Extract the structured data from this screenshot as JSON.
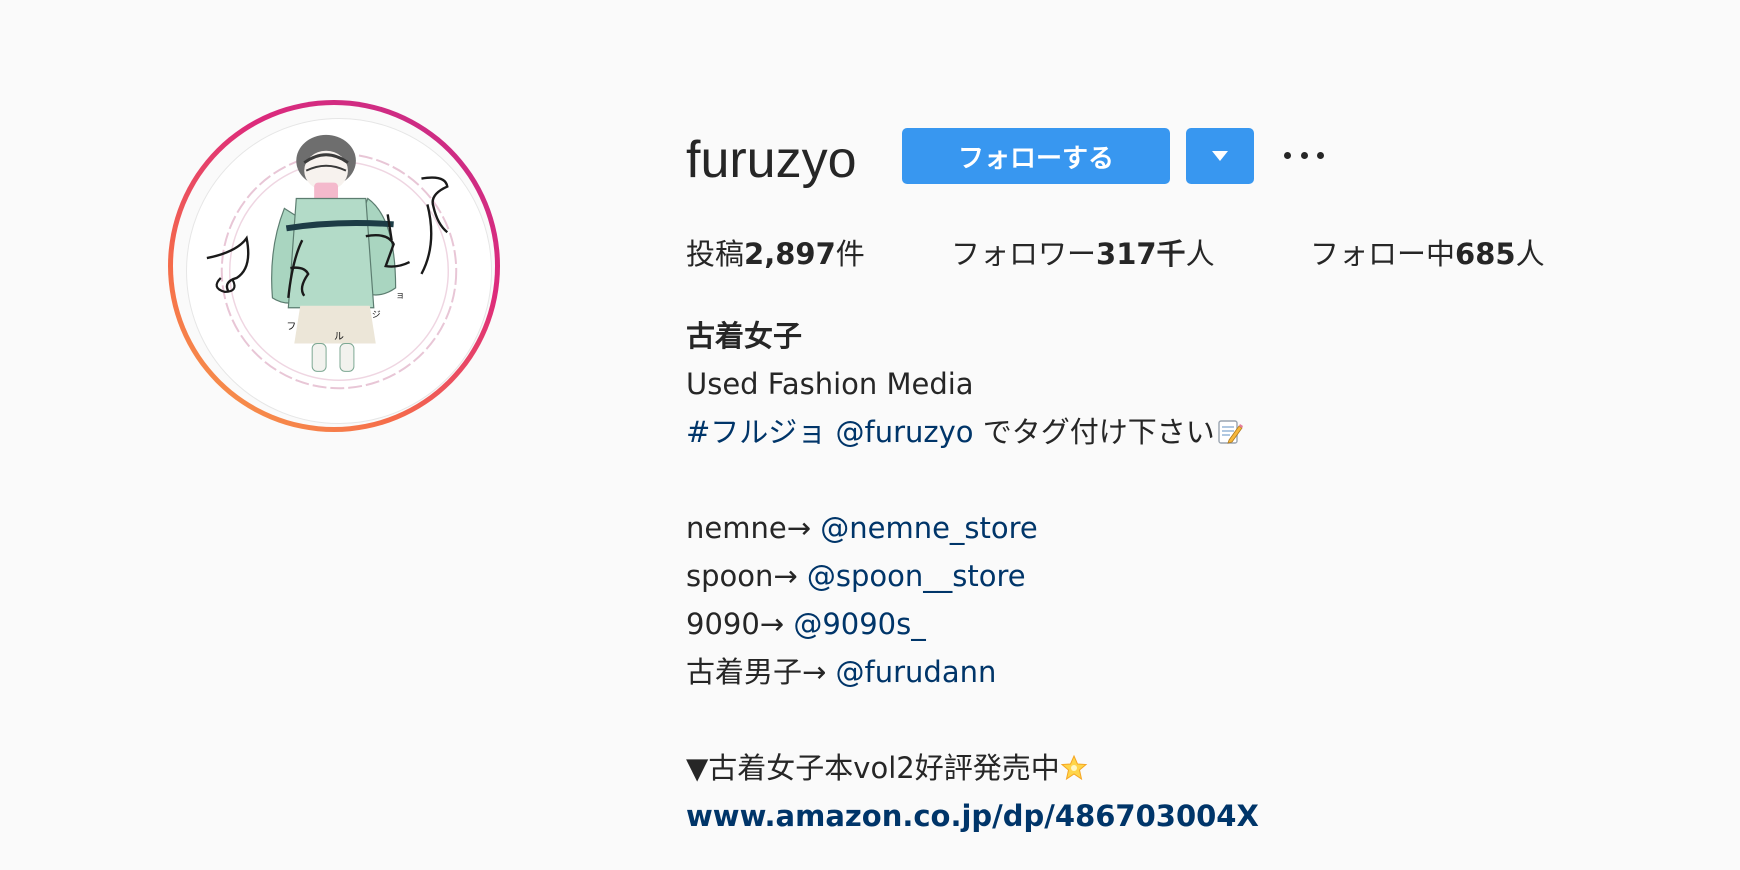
{
  "profile": {
    "username": "furuzyo",
    "follow_label": "フォローする",
    "dropdown_icon": "chevron-down-icon",
    "more_icon": "more-options-icon"
  },
  "stats": {
    "posts_label": "投稿",
    "posts_value": "2,897",
    "posts_unit": "件",
    "followers_label": "フォロワー",
    "followers_value": "317千",
    "followers_unit": "人",
    "following_label": "フォロー中",
    "following_value": "685",
    "following_unit": "人"
  },
  "bio": {
    "display_name": "古着女子",
    "tagline": "Used Fashion Media",
    "hashtag": "#フルジョ",
    "mention_self": "@furuzyo",
    "tag_text": " でタグ付け下さい",
    "shops": [
      {
        "prefix": "nemne→ ",
        "handle": "@nemne_store"
      },
      {
        "prefix": "spoon→ ",
        "handle": "@spoon__store"
      },
      {
        "prefix": "9090→ ",
        "handle": "@9090s_"
      },
      {
        "prefix": "古着男子→ ",
        "handle": "@furudann"
      }
    ],
    "book_text": "▼古着女子本vol2好評発売中",
    "url": "www.amazon.co.jp/dp/486703004X"
  },
  "colors": {
    "primary_button": "#3897f0",
    "link": "#003569",
    "background": "#fafafa",
    "text": "#262626"
  }
}
